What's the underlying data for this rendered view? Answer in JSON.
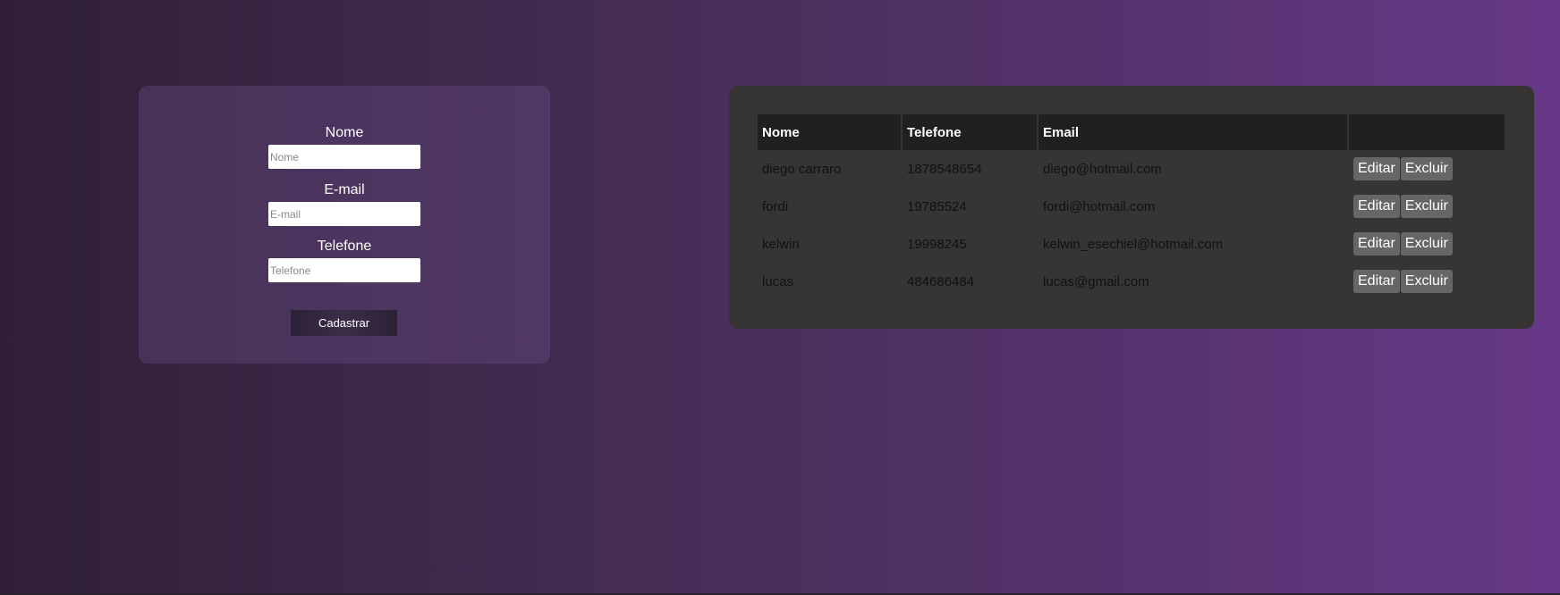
{
  "form": {
    "fields": [
      {
        "label": "Nome",
        "placeholder": "Nome"
      },
      {
        "label": "E-mail",
        "placeholder": "E-mail"
      },
      {
        "label": "Telefone",
        "placeholder": "Telefone"
      }
    ],
    "submit_label": "Cadastrar"
  },
  "table": {
    "headers": [
      "Nome",
      "Telefone",
      "Email",
      ""
    ],
    "edit_label": "Editar",
    "delete_label": "Excluir",
    "rows": [
      {
        "nome": "diego carraro",
        "telefone": "1878548654",
        "email": "diego@hotmail.com"
      },
      {
        "nome": "fordi",
        "telefone": "19785524",
        "email": "fordi@hotmail.com"
      },
      {
        "nome": "kelwin",
        "telefone": "19998245",
        "email": "kelwin_esechiel@hotmail.com"
      },
      {
        "nome": "lucas",
        "telefone": "484686484",
        "email": "lucas@gmail.com"
      }
    ]
  }
}
